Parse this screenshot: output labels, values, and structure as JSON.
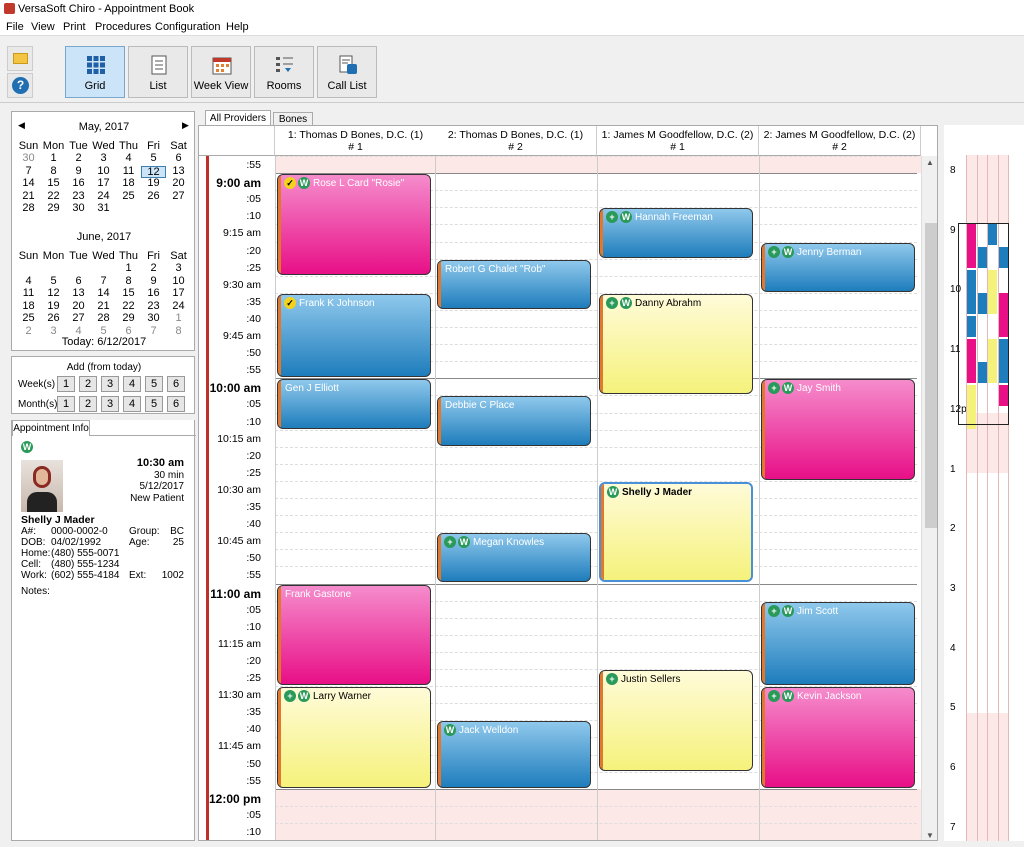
{
  "window": {
    "title": "VersaSoft Chiro - Appointment Book"
  },
  "menu": [
    "File",
    "View",
    "Print",
    "Procedures",
    "Configuration",
    "Help"
  ],
  "toolbar": {
    "grid": "Grid",
    "list": "List",
    "week": "Week View",
    "rooms": "Rooms",
    "call": "Call List"
  },
  "may": {
    "title": "May, 2017",
    "days": [
      "Sun",
      "Mon",
      "Tue",
      "Wed",
      "Thu",
      "Fri",
      "Sat"
    ],
    "rows": [
      [
        "30",
        "1",
        "2",
        "3",
        "4",
        "5",
        "6"
      ],
      [
        "7",
        "8",
        "9",
        "10",
        "11",
        "12",
        "13"
      ],
      [
        "14",
        "15",
        "16",
        "17",
        "18",
        "19",
        "20"
      ],
      [
        "21",
        "22",
        "23",
        "24",
        "25",
        "26",
        "27"
      ],
      [
        "28",
        "29",
        "30",
        "31",
        "",
        "",
        ""
      ]
    ]
  },
  "june": {
    "title": "June, 2017",
    "days": [
      "Sun",
      "Mon",
      "Tue",
      "Wed",
      "Thu",
      "Fri",
      "Sat"
    ],
    "rows": [
      [
        "",
        "",
        "",
        "",
        "1",
        "2",
        "3"
      ],
      [
        "4",
        "5",
        "6",
        "7",
        "8",
        "9",
        "10"
      ],
      [
        "11",
        "12",
        "13",
        "14",
        "15",
        "16",
        "17"
      ],
      [
        "18",
        "19",
        "20",
        "21",
        "22",
        "23",
        "24"
      ],
      [
        "25",
        "26",
        "27",
        "28",
        "29",
        "30",
        "1"
      ],
      [
        "2",
        "3",
        "4",
        "5",
        "6",
        "7",
        "8"
      ]
    ]
  },
  "today": "Today: 6/12/2017",
  "add": {
    "title": "Add (from today)",
    "weeks": "Week(s)",
    "months": "Month(s)",
    "nums": [
      "1",
      "2",
      "3",
      "4",
      "5",
      "6"
    ]
  },
  "info": {
    "tab": "Appointment Info",
    "time": "10:30 am",
    "dur": "30 min",
    "date": "5/12/2017",
    "type": "New Patient",
    "name": "Shelly J Mader",
    "acct_l": "A#:",
    "acct": "0000-0002-0",
    "group_l": "Group:",
    "group": "BC",
    "dob_l": "DOB:",
    "dob": "04/02/1992",
    "age_l": "Age:",
    "age": "25",
    "home_l": "Home:",
    "home": "(480) 555-0071",
    "cell_l": "Cell:",
    "cell": "(480) 555-1234",
    "work_l": "Work:",
    "work": "(602) 555-4184",
    "ext_l": "Ext:",
    "ext": "1002",
    "notes_l": "Notes:"
  },
  "tabs": [
    "All Providers",
    "Bones"
  ],
  "columns": [
    {
      "l1": "1: Thomas D Bones, D.C. (1)",
      "l2": "# 1"
    },
    {
      "l1": "2: Thomas D Bones, D.C. (1)",
      "l2": "# 2"
    },
    {
      "l1": "1: James M Goodfellow, D.C. (2)",
      "l2": "# 1"
    },
    {
      "l1": "2: James M Goodfellow, D.C. (2)",
      "l2": "# 2"
    }
  ],
  "times": [
    ":55",
    "9:00 am",
    ":05",
    ":10",
    "9:15 am",
    ":20",
    ":25",
    "9:30 am",
    ":35",
    ":40",
    "9:45 am",
    ":50",
    ":55",
    "10:00 am",
    ":05",
    ":10",
    "10:15 am",
    ":20",
    ":25",
    "10:30 am",
    ":35",
    ":40",
    "10:45 am",
    ":50",
    ":55",
    "11:00 am",
    ":05",
    ":10",
    "11:15 am",
    ":20",
    ":25",
    "11:30 am",
    ":35",
    ":40",
    "11:45 am",
    ":50",
    ":55",
    "12:00 pm",
    ":05",
    ":10"
  ],
  "appts": [
    {
      "name": "Rose L Card \"Rosie\"",
      "col": 0,
      "start": 1,
      "len": 6,
      "color": "pink",
      "badges": [
        "c",
        "w"
      ]
    },
    {
      "name": "Frank K Johnson",
      "col": 0,
      "start": 8,
      "len": 5,
      "color": "blue",
      "badges": [
        "c"
      ]
    },
    {
      "name": "Gen J Elliott",
      "col": 0,
      "start": 13,
      "len": 3,
      "color": "blue",
      "badges": []
    },
    {
      "name": "Frank Gastone",
      "col": 0,
      "start": 25,
      "len": 6,
      "color": "pink",
      "badges": []
    },
    {
      "name": "Larry Warner",
      "col": 0,
      "start": 31,
      "len": 6,
      "color": "yellow",
      "badges": [
        "p",
        "w"
      ]
    },
    {
      "name": "Robert G Chalet \"Rob\"",
      "col": 1,
      "start": 6,
      "len": 3,
      "color": "blue",
      "badges": []
    },
    {
      "name": "Debbie C Place",
      "col": 1,
      "start": 14,
      "len": 3,
      "color": "blue",
      "badges": []
    },
    {
      "name": "Megan Knowles",
      "col": 1,
      "start": 22,
      "len": 3,
      "color": "blue",
      "badges": [
        "p",
        "w"
      ]
    },
    {
      "name": "Jack Welldon",
      "col": 1,
      "start": 33,
      "len": 4,
      "color": "blue",
      "badges": [
        "w"
      ]
    },
    {
      "name": "Hannah Freeman",
      "col": 2,
      "start": 3,
      "len": 3,
      "color": "blue",
      "badges": [
        "p",
        "w"
      ]
    },
    {
      "name": "Danny Abrahm",
      "col": 2,
      "start": 8,
      "len": 6,
      "color": "yellow",
      "badges": [
        "p",
        "w"
      ]
    },
    {
      "name": "Shelly J Mader",
      "col": 2,
      "start": 19,
      "len": 6,
      "color": "yellow",
      "badges": [
        "w"
      ]
    },
    {
      "name": "Justin Sellers",
      "col": 2,
      "start": 30,
      "len": 6,
      "color": "yellow",
      "badges": [
        "p"
      ]
    },
    {
      "name": "Jenny Berman",
      "col": 3,
      "start": 5,
      "len": 3,
      "color": "blue",
      "badges": [
        "p",
        "w"
      ]
    },
    {
      "name": "Jay Smith",
      "col": 3,
      "start": 13,
      "len": 6,
      "color": "pink",
      "badges": [
        "p",
        "w"
      ]
    },
    {
      "name": "Jim Scott",
      "col": 3,
      "start": 26,
      "len": 5,
      "color": "blue",
      "badges": [
        "p",
        "w"
      ]
    },
    {
      "name": "Kevin Jackson",
      "col": 3,
      "start": 31,
      "len": 6,
      "color": "pink",
      "badges": [
        "p",
        "w"
      ]
    }
  ],
  "mini_hours": [
    "8",
    "9",
    "10",
    "11",
    "12p",
    "1",
    "2",
    "3",
    "4",
    "5",
    "6",
    "7"
  ],
  "colors": {
    "pink": "#e80f87",
    "blue": "#1e7dbc",
    "yellow": "#f5f27c"
  }
}
